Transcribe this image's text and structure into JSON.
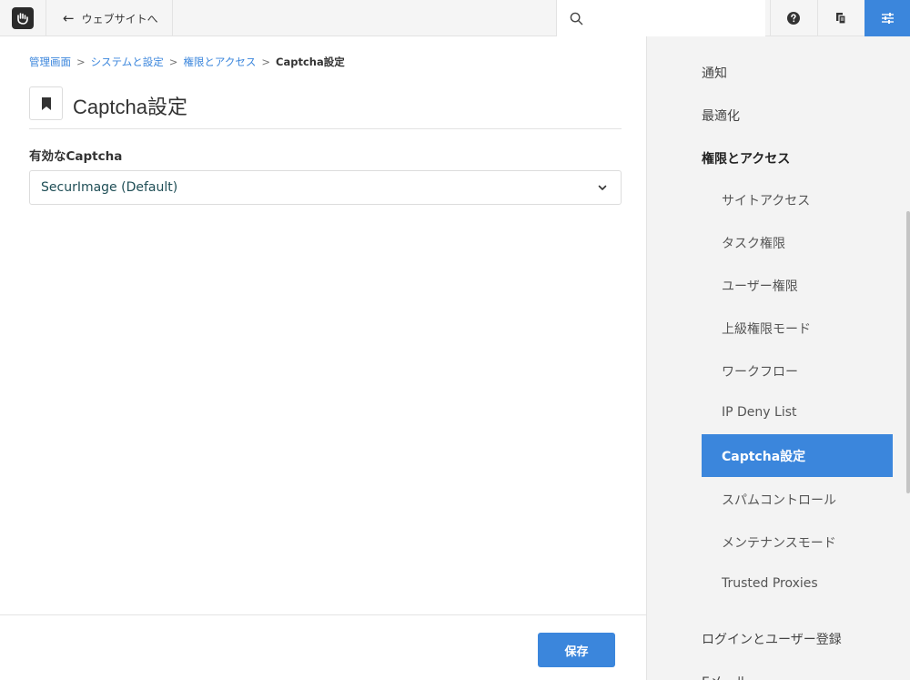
{
  "toolbar": {
    "back_label": "ウェブサイトへ",
    "search_placeholder": ""
  },
  "breadcrumb": {
    "items": [
      "管理画面",
      "システムと設定",
      "権限とアクセス"
    ],
    "separator": ">",
    "current": "Captcha設定"
  },
  "page": {
    "title": "Captcha設定",
    "field_label": "有効なCaptcha",
    "select_value": "SecurImage (Default)",
    "save_label": "保存"
  },
  "sidebar": {
    "items_top": [
      "通知",
      "最適化"
    ],
    "section": "権限とアクセス",
    "sub_items": [
      "サイトアクセス",
      "タスク権限",
      "ユーザー権限",
      "上級権限モード",
      "ワークフロー",
      "IP Deny List",
      "Captcha設定",
      "スパムコントロール",
      "メンテナンスモード",
      "Trusted Proxies"
    ],
    "active_index": 6,
    "items_bottom": [
      "ログインとユーザー登録",
      "Eメール"
    ]
  },
  "colors": {
    "accent": "#3b86dc",
    "sidebar_bg": "#f3f3f3",
    "select_text": "#1f4e56"
  },
  "icons": {
    "logo": "concrete-hand-icon",
    "back": "arrow-left-icon",
    "search": "search-icon",
    "help": "question-circle-icon",
    "pages": "copy-icon",
    "settings": "sliders-icon",
    "bookmark": "bookmark-icon",
    "chevron": "chevron-down-icon"
  }
}
